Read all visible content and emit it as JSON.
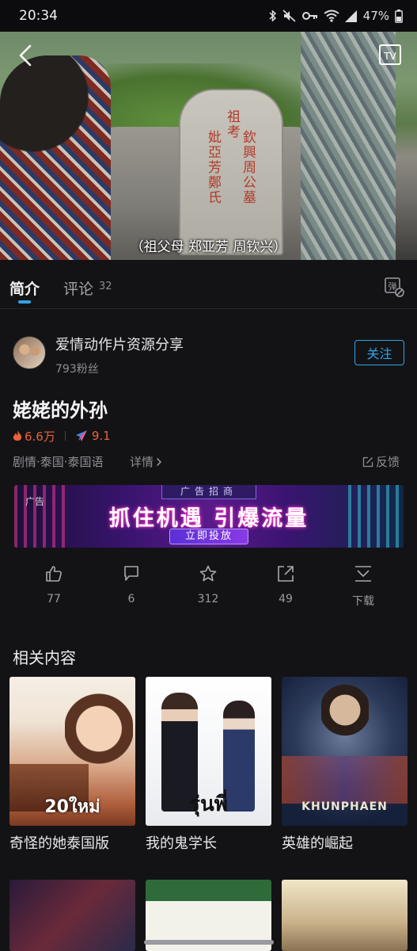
{
  "status_bar": {
    "time": "20:34",
    "battery": "47%"
  },
  "video": {
    "subtitle": "（祖父母 郑亚芳 周钦兴）",
    "stone_text": [
      "祖",
      "考",
      "妣",
      "亞",
      "芳",
      "鄭",
      "氏",
      "欽",
      "興",
      "周",
      "公",
      "墓"
    ]
  },
  "tabs": {
    "intro": "简介",
    "comments": "评论",
    "comments_count": "32"
  },
  "uploader": {
    "name": "爱情动作片资源分享",
    "fans": "793粉丝",
    "follow": "关注"
  },
  "movie": {
    "title": "姥姥的外孙",
    "heat": "6.6万",
    "score": "9.1",
    "genre": "剧情·泰国·泰国语",
    "details": "详情",
    "feedback": "反馈"
  },
  "banner": {
    "ad_tag": "广告",
    "top_label": "广告招商",
    "main": "抓住机遇 引爆流量",
    "button": "立即投放"
  },
  "actions": [
    {
      "icon": "like-icon",
      "count": "77"
    },
    {
      "icon": "dislike-icon",
      "count": "6"
    },
    {
      "icon": "star-icon",
      "count": "312"
    },
    {
      "icon": "share-icon",
      "count": "49"
    },
    {
      "icon": "download-icon",
      "count": "下载"
    }
  ],
  "related": {
    "title": "相关内容",
    "items": [
      {
        "title": "奇怪的她泰国版",
        "poster_text": "20ใหม่"
      },
      {
        "title": "我的鬼学长",
        "poster_text": "รุ่นพี่"
      },
      {
        "title": "英雄的崛起",
        "poster_text": "KHUNPHAEN"
      }
    ]
  },
  "colors": {
    "accent": "#2fa3e6",
    "heat": "#e8623a",
    "background": "#131316"
  }
}
